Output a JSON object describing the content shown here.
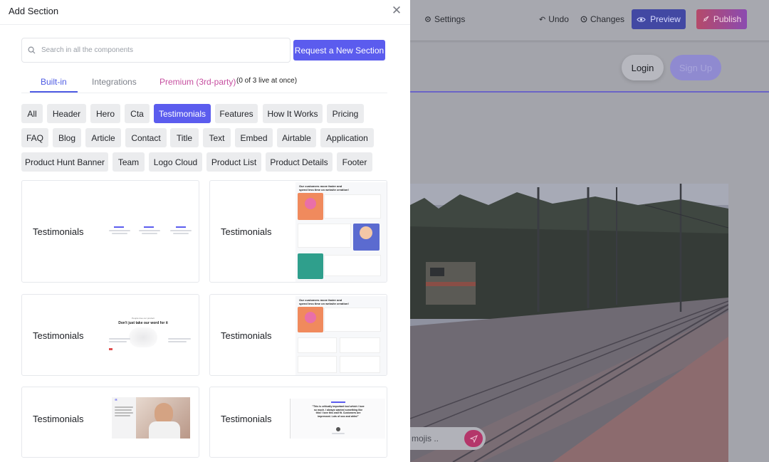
{
  "editor": {
    "settings_label": "Settings",
    "undo_label": "Undo",
    "changes_label": "Changes",
    "preview_label": "Preview",
    "publish_label": "Publish",
    "login_label": "Login",
    "signup_label": "Sign Up",
    "chat_placeholder": "mojis .."
  },
  "panel": {
    "title": "Add Section",
    "search_placeholder": "Search in all the components",
    "request_button": "Request a New Section",
    "tabs": [
      {
        "label": "Built-in",
        "active": true
      },
      {
        "label": "Integrations",
        "active": false
      },
      {
        "label": "Premium (3rd-party)",
        "active": false
      }
    ],
    "premium_note": "(0 of 3 live at once)",
    "categories_row1": [
      "All",
      "Header",
      "Hero",
      "Cta",
      "Testimonials",
      "Features",
      "How It Works",
      "Pricing"
    ],
    "categories_row2": [
      "FAQ",
      "Blog",
      "Article",
      "Contact",
      "Title",
      "Text",
      "Embed",
      "Airtable",
      "Application"
    ],
    "categories_row3": [
      "Product Hunt Banner",
      "Team",
      "Logo Cloud",
      "Product List",
      "Product Details",
      "Footer"
    ],
    "selected_category": "Testimonials",
    "cards": [
      {
        "label": "Testimonials"
      },
      {
        "label": "Testimonials"
      },
      {
        "label": "Testimonials"
      },
      {
        "label": "Testimonials"
      },
      {
        "label": "Testimonials"
      },
      {
        "label": "Testimonials"
      }
    ],
    "thumb_texts": {
      "t2_heading": "Our customers move faster and spend less time on website creation!",
      "t3_kicker": "People love our product",
      "t3_heading": "Don't just take our word for it",
      "t4_heading": "Our customers move faster and spend less time on website creation!",
      "t6_quote": "\"This is critically important tool which I love so much. I always wanted something like this! I love this wall fit. Customers are impressed. Lots of ooo and ahhs!\""
    }
  },
  "colors": {
    "accent": "#5b5cee",
    "premium": "#c64fa0",
    "publish": "#d94a5e"
  }
}
